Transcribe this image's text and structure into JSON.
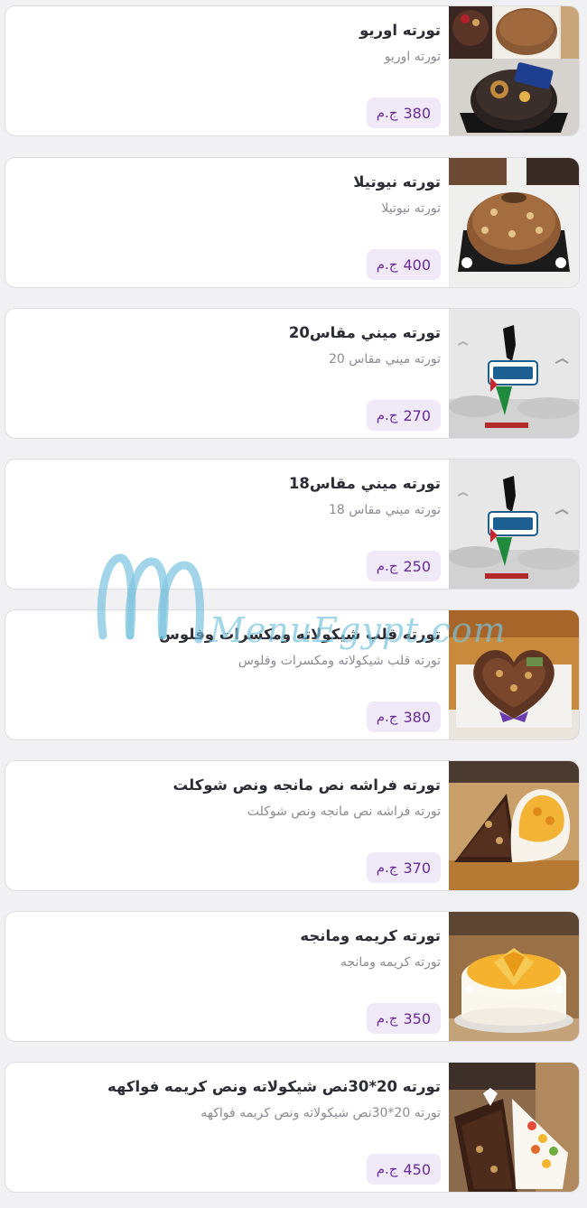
{
  "currency": "ج.م",
  "watermark": "MenuEgypt.com",
  "items": [
    {
      "name": "تورته اوريو",
      "desc": "تورته اوريو",
      "price": "380",
      "image": "oreo-cake"
    },
    {
      "name": "تورته نيوتيلا",
      "desc": "تورته نيوتيلا",
      "price": "400",
      "image": "nutella-cake"
    },
    {
      "name": "تورته ميني مقاس20",
      "desc": "تورته ميني مقاس 20",
      "price": "270",
      "image": "palestine-cake"
    },
    {
      "name": "تورته ميني مقاس18",
      "desc": "تورته ميني مقاس 18",
      "price": "250",
      "image": "palestine-cake"
    },
    {
      "name": "تورته قلب شيكولاته ومكسرات وفلوس",
      "desc": "تورته قلب شيكولاته ومكسرات وفلوس",
      "price": "380",
      "image": "heart-cake"
    },
    {
      "name": "تورته فراشه نص مانجه ونص شوكلت",
      "desc": "تورته فراشه نص مانجه ونص شوكلت",
      "price": "370",
      "image": "butterfly-cake"
    },
    {
      "name": "تورته كريمه ومانجه",
      "desc": "تورته كريمه ومانجه",
      "price": "350",
      "image": "mango-cake"
    },
    {
      "name": "تورته 20*30نص شيكولاته ونص كريمه فواكهه",
      "desc": "تورته 20*30نص شيكولاته ونص كريمه فواكهه",
      "price": "450",
      "image": "fruit-cake"
    }
  ]
}
